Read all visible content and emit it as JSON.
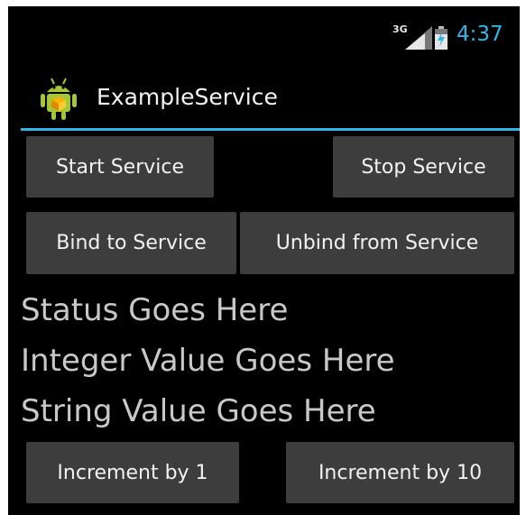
{
  "status_bar": {
    "network_type": "3G",
    "time": "4:37",
    "icons": [
      "signal-icon",
      "battery-charging-icon"
    ]
  },
  "action_bar": {
    "icon": "android-app-icon",
    "title": "ExampleService",
    "accent_color": "#33b5e5"
  },
  "controls": {
    "start_label": "Start Service",
    "stop_label": "Stop Service",
    "bind_label": "Bind to Service",
    "unbind_label": "Unbind from Service",
    "inc1_label": "Increment by 1",
    "inc10_label": "Increment by 10"
  },
  "output": {
    "status": "Status Goes Here",
    "integer_value": "Integer Value Goes Here",
    "string_value": "String Value Goes Here"
  }
}
